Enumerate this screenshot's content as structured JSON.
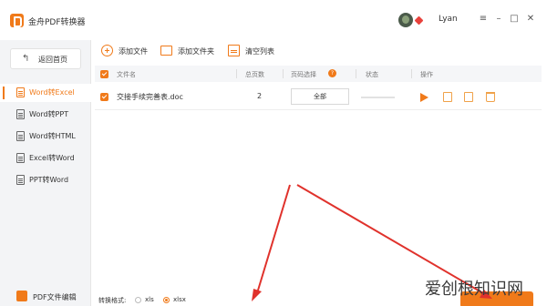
{
  "app": {
    "title": "金舟PDF转换器"
  },
  "user": {
    "name": "Lyan"
  },
  "window": {
    "menu_glyph": "≡",
    "min_glyph": "–",
    "max_glyph": "□",
    "close_glyph": "✕"
  },
  "sidebar": {
    "back_label": "返回首页",
    "back_icon": "↰",
    "items": [
      {
        "label": "Word转Excel",
        "active": true
      },
      {
        "label": "Word转PPT",
        "active": false
      },
      {
        "label": "Word转HTML",
        "active": false
      },
      {
        "label": "Excel转Word",
        "active": false
      },
      {
        "label": "PPT转Word",
        "active": false
      }
    ],
    "pdf_edit_label": "PDF文件编辑"
  },
  "toolbar": {
    "add_file": "添加文件",
    "add_folder": "添加文件夹",
    "clear_list": "清空列表"
  },
  "table": {
    "headers": {
      "filename": "文件名",
      "total_pages": "总页数",
      "page_select": "页码选择",
      "status": "状态",
      "actions": "操作"
    },
    "help_glyph": "?",
    "rows": [
      {
        "filename": "交接手续完善表.doc",
        "pages": "2",
        "page_select": "全部"
      }
    ]
  },
  "bottom": {
    "format_label": "转换格式:",
    "options": [
      {
        "label": "xls",
        "selected": false
      },
      {
        "label": "xlsx",
        "selected": true
      }
    ]
  },
  "watermark": {
    "text": "爱创根知识网"
  },
  "colors": {
    "accent": "#f07a1a",
    "arrow": "#e0322c"
  }
}
